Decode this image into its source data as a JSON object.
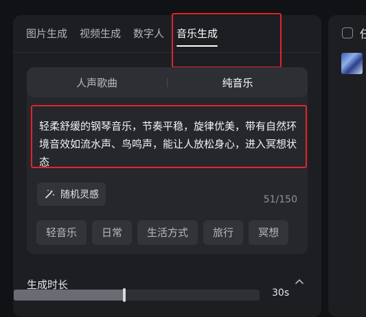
{
  "tabs": [
    {
      "label": "图片生成",
      "active": false
    },
    {
      "label": "视频生成",
      "active": false
    },
    {
      "label": "数字人",
      "active": false
    },
    {
      "label": "音乐生成",
      "active": true
    }
  ],
  "mode_toggle": {
    "options": [
      "人声歌曲",
      "纯音乐"
    ],
    "selected": "纯音乐"
  },
  "prompt": {
    "value": "轻柔舒缓的钢琴音乐，节奏平稳，旋律优美，带有自然环境音效如流水声、鸟鸣声，能让人放松身心，进入冥想状态",
    "char_count": "51/150"
  },
  "random_button": {
    "label": "随机灵感",
    "icon": "magic-wand-icon"
  },
  "tags": [
    "轻音乐",
    "日常",
    "生活方式",
    "旅行",
    "冥想"
  ],
  "duration_section": {
    "title": "生成时长",
    "value_label": "30s",
    "level_fraction": 0.45
  },
  "right_panel": {
    "title_partial": "任"
  },
  "colors": {
    "background": "#111215",
    "panel": "#1d1e22",
    "highlight_box": "#e0262c"
  }
}
